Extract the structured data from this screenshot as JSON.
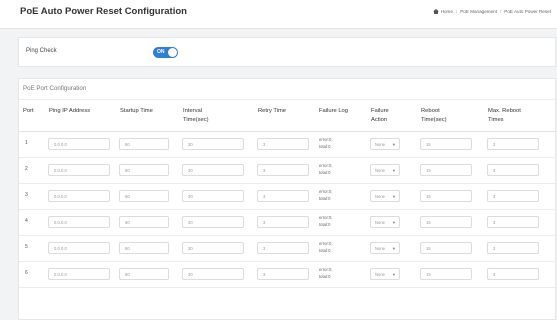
{
  "header": {
    "title": "PoE Auto Power Reset Configuration",
    "breadcrumb": [
      "Home",
      "PoE Management",
      "PoE Auto Power Reset"
    ]
  },
  "ping_check": {
    "label": "Ping Check",
    "toggle_text": "ON",
    "enabled": true
  },
  "poe_config": {
    "section_title": "PoE Port Configuration",
    "columns": [
      "Port",
      "Ping IP Address",
      "Startup Time",
      "Interval Time(sec)",
      "Retry Time",
      "Failure Log",
      "Failure Action",
      "Reboot Time(sec)",
      "Max. Reboot Times"
    ],
    "rows": [
      {
        "port": "1",
        "ip": "0.0.0.0",
        "startup": "60",
        "interval": "30",
        "retry": "3",
        "log": [
          "error:0,",
          "total:0"
        ],
        "action": "None",
        "reboot": "15",
        "max": "3"
      },
      {
        "port": "2",
        "ip": "0.0.0.0",
        "startup": "60",
        "interval": "30",
        "retry": "3",
        "log": [
          "error:0,",
          "total:0"
        ],
        "action": "None",
        "reboot": "15",
        "max": "3"
      },
      {
        "port": "3",
        "ip": "0.0.0.0",
        "startup": "60",
        "interval": "30",
        "retry": "3",
        "log": [
          "error:0,",
          "total:0"
        ],
        "action": "None",
        "reboot": "15",
        "max": "3"
      },
      {
        "port": "4",
        "ip": "0.0.0.0",
        "startup": "60",
        "interval": "30",
        "retry": "3",
        "log": [
          "error:0,",
          "total:0"
        ],
        "action": "None",
        "reboot": "15",
        "max": "3"
      },
      {
        "port": "5",
        "ip": "0.0.0.0",
        "startup": "60",
        "interval": "30",
        "retry": "3",
        "log": [
          "error:0,",
          "total:0"
        ],
        "action": "None",
        "reboot": "15",
        "max": "3"
      },
      {
        "port": "6",
        "ip": "0.0.0.0",
        "startup": "60",
        "interval": "30",
        "retry": "3",
        "log": [
          "error:0,",
          "total:0"
        ],
        "action": "None",
        "reboot": "15",
        "max": "3"
      }
    ]
  },
  "colors": {
    "accent": "#2f7ed8",
    "background": "#f2f3f5",
    "panel": "#ffffff"
  }
}
